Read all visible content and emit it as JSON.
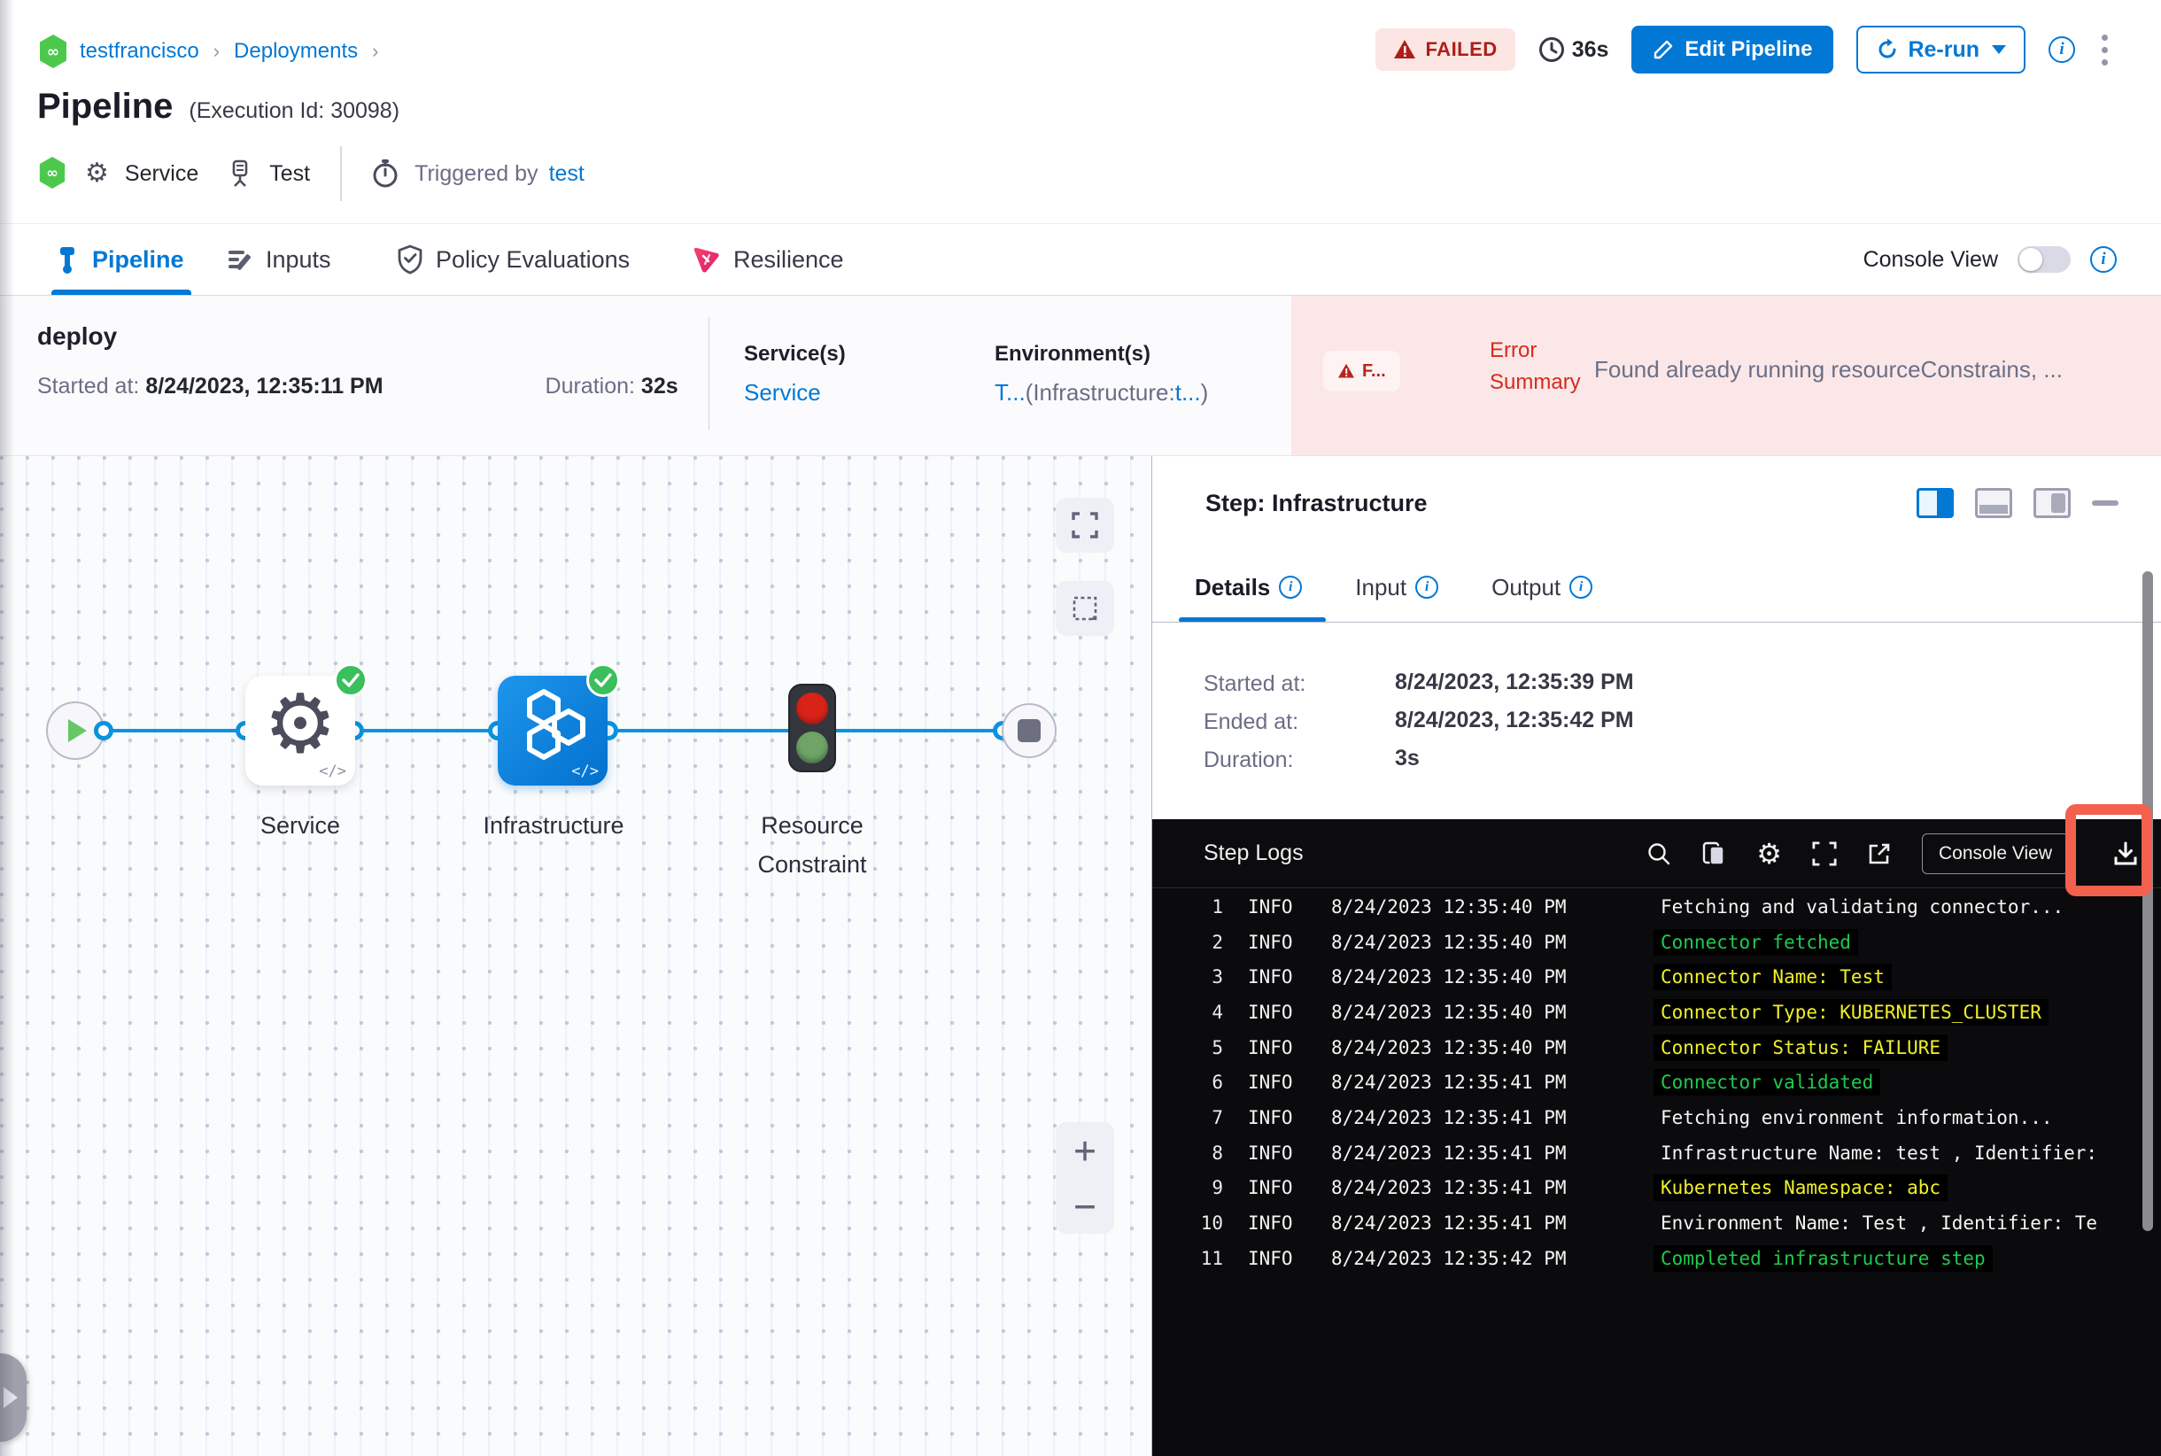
{
  "header": {
    "breadcrumb": {
      "project": "testfrancisco",
      "section": "Deployments"
    },
    "status": "FAILED",
    "elapsed": "36s",
    "edit_button": "Edit Pipeline",
    "rerun_button": "Re-run",
    "title": "Pipeline",
    "execution_id": "(Execution Id: 30098)",
    "meta": {
      "service": "Service",
      "test": "Test",
      "triggered_label": "Triggered by",
      "triggered_by": "test"
    }
  },
  "tabs": {
    "items": [
      {
        "label": "Pipeline"
      },
      {
        "label": "Inputs"
      },
      {
        "label": "Policy Evaluations"
      },
      {
        "label": "Resilience"
      }
    ],
    "console_view_label": "Console View"
  },
  "stage": {
    "name": "deploy",
    "started_label": "Started at:",
    "started": "8/24/2023, 12:35:11 PM",
    "duration_label": "Duration:",
    "duration": "32s",
    "services_label": "Service(s)",
    "service": "Service",
    "environments_label": "Environment(s)",
    "env_t": "T...",
    "env_infra": "(Infrastructure:",
    "env_t2": "t...",
    "env_close": ")",
    "error_badge": "F...",
    "error_label_line1": "Error",
    "error_label_line2": "Summary",
    "error_text": "Found already running resourceConstrains, ..."
  },
  "graph": {
    "nodes": [
      {
        "label": "Service",
        "code_tag": "</>"
      },
      {
        "label": "Infrastructure",
        "code_tag": "</>"
      },
      {
        "label_line1": "Resource",
        "label_line2": "Constraint"
      }
    ]
  },
  "panel": {
    "title": "Step: Infrastructure",
    "tabs": [
      {
        "label": "Details"
      },
      {
        "label": "Input"
      },
      {
        "label": "Output"
      }
    ],
    "details": {
      "started_label": "Started at:",
      "started": "8/24/2023, 12:35:39 PM",
      "ended_label": "Ended at:",
      "ended": "8/24/2023, 12:35:42 PM",
      "duration_label": "Duration:",
      "duration": "3s"
    },
    "logs": {
      "title": "Step Logs",
      "console_view_button": "Console View",
      "lines": [
        {
          "n": "1",
          "level": "INFO",
          "time": "8/24/2023 12:35:40 PM",
          "msg": "Fetching and validating connector...",
          "color": "white"
        },
        {
          "n": "2",
          "level": "INFO",
          "time": "8/24/2023 12:35:40 PM",
          "msg": "Connector fetched",
          "color": "green"
        },
        {
          "n": "3",
          "level": "INFO",
          "time": "8/24/2023 12:35:40 PM",
          "msg": "Connector Name: Test",
          "color": "yellow"
        },
        {
          "n": "4",
          "level": "INFO",
          "time": "8/24/2023 12:35:40 PM",
          "msg": "Connector Type: KUBERNETES_CLUSTER",
          "color": "yellow"
        },
        {
          "n": "5",
          "level": "INFO",
          "time": "8/24/2023 12:35:40 PM",
          "msg": "Connector Status: FAILURE",
          "color": "yellow"
        },
        {
          "n": "6",
          "level": "INFO",
          "time": "8/24/2023 12:35:41 PM",
          "msg": "Connector validated",
          "color": "green"
        },
        {
          "n": "7",
          "level": "INFO",
          "time": "8/24/2023 12:35:41 PM",
          "msg": "Fetching environment information...",
          "color": "white"
        },
        {
          "n": "8",
          "level": "INFO",
          "time": "8/24/2023 12:35:41 PM",
          "msg": "Infrastructure Name: test , Identifier:",
          "color": "white"
        },
        {
          "n": "9",
          "level": "INFO",
          "time": "8/24/2023 12:35:41 PM",
          "msg": "Kubernetes Namespace: abc",
          "color": "yellow"
        },
        {
          "n": "10",
          "level": "INFO",
          "time": "8/24/2023 12:35:41 PM",
          "msg": "Environment Name: Test , Identifier: Te",
          "color": "white"
        },
        {
          "n": "11",
          "level": "INFO",
          "time": "8/24/2023 12:35:42 PM",
          "msg": "Completed infrastructure step",
          "color": "green"
        }
      ]
    }
  },
  "colors": {
    "primary": "#0278d5",
    "failed_red": "#ae1e19",
    "error_bg": "#fbe7e7",
    "log_green": "#1ecb4f",
    "log_yellow": "#f0f02a",
    "annotation_red": "#f4604e"
  }
}
